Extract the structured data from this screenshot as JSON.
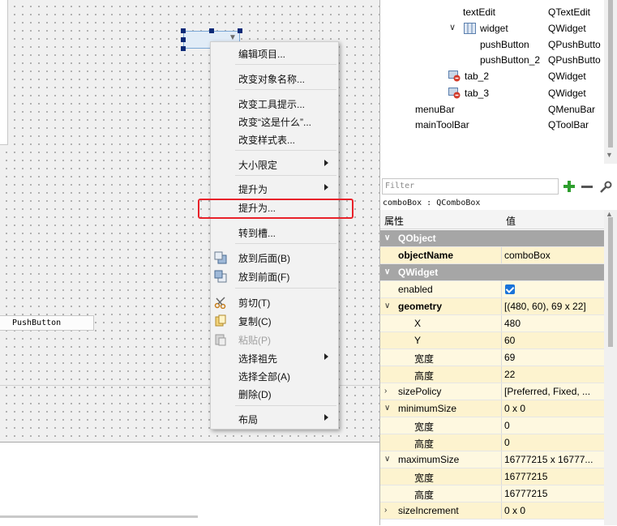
{
  "canvas": {
    "pushbutton_label": "PushButton"
  },
  "context_menu": {
    "items": [
      {
        "label": "编辑项目..."
      },
      {
        "label": "改变对象名称..."
      },
      {
        "label": "改变工具提示..."
      },
      {
        "label": "改变“这是什么”..."
      },
      {
        "label": "改变样式表..."
      },
      {
        "label": "大小限定"
      },
      {
        "label": "提升为"
      },
      {
        "label": "提升为..."
      },
      {
        "label": "转到槽..."
      },
      {
        "label": "放到后面(B)"
      },
      {
        "label": "放到前面(F)"
      },
      {
        "label": "剪切(T)"
      },
      {
        "label": "复制(C)"
      },
      {
        "label": "粘贴(P)"
      },
      {
        "label": "选择祖先"
      },
      {
        "label": "选择全部(A)"
      },
      {
        "label": "删除(D)"
      },
      {
        "label": "布局"
      }
    ]
  },
  "object_tree": {
    "rows": [
      {
        "name": "textEdit",
        "class": "QTextEdit"
      },
      {
        "name": "widget",
        "class": "QWidget"
      },
      {
        "name": "pushButton",
        "class": "QPushButto"
      },
      {
        "name": "pushButton_2",
        "class": "QPushButto"
      },
      {
        "name": "tab_2",
        "class": "QWidget"
      },
      {
        "name": "tab_3",
        "class": "QWidget"
      },
      {
        "name": "menuBar",
        "class": "QMenuBar"
      },
      {
        "name": "mainToolBar",
        "class": "QToolBar"
      }
    ]
  },
  "property_editor": {
    "filter_placeholder": "Filter",
    "selected_label": "comboBox : QComboBox",
    "header_property": "属性",
    "header_value": "值",
    "rows": [
      {
        "key": "QObject",
        "value": ""
      },
      {
        "key": "objectName",
        "value": "comboBox"
      },
      {
        "key": "QWidget",
        "value": ""
      },
      {
        "key": "enabled",
        "value": "",
        "checked": true
      },
      {
        "key": "geometry",
        "value": "[(480, 60), 69 x 22]"
      },
      {
        "key": "X",
        "value": "480"
      },
      {
        "key": "Y",
        "value": "60"
      },
      {
        "key": "宽度",
        "value": "69"
      },
      {
        "key": "高度",
        "value": "22"
      },
      {
        "key": "sizePolicy",
        "value": "[Preferred, Fixed, ..."
      },
      {
        "key": "minimumSize",
        "value": "0 x 0"
      },
      {
        "key": "宽度",
        "value": "0"
      },
      {
        "key": "高度",
        "value": "0"
      },
      {
        "key": "maximumSize",
        "value": "16777215 x 16777..."
      },
      {
        "key": "宽度",
        "value": "16777215"
      },
      {
        "key": "高度",
        "value": "16777215"
      },
      {
        "key": "sizeIncrement",
        "value": "0 x 0"
      }
    ]
  },
  "colors": {
    "highlight_border": "#e8222a",
    "group_header": "#a6a6a6",
    "property_row": "#fdf3cf",
    "checkbox": "#1a73d9",
    "add_icon": "#2e9e2e"
  }
}
